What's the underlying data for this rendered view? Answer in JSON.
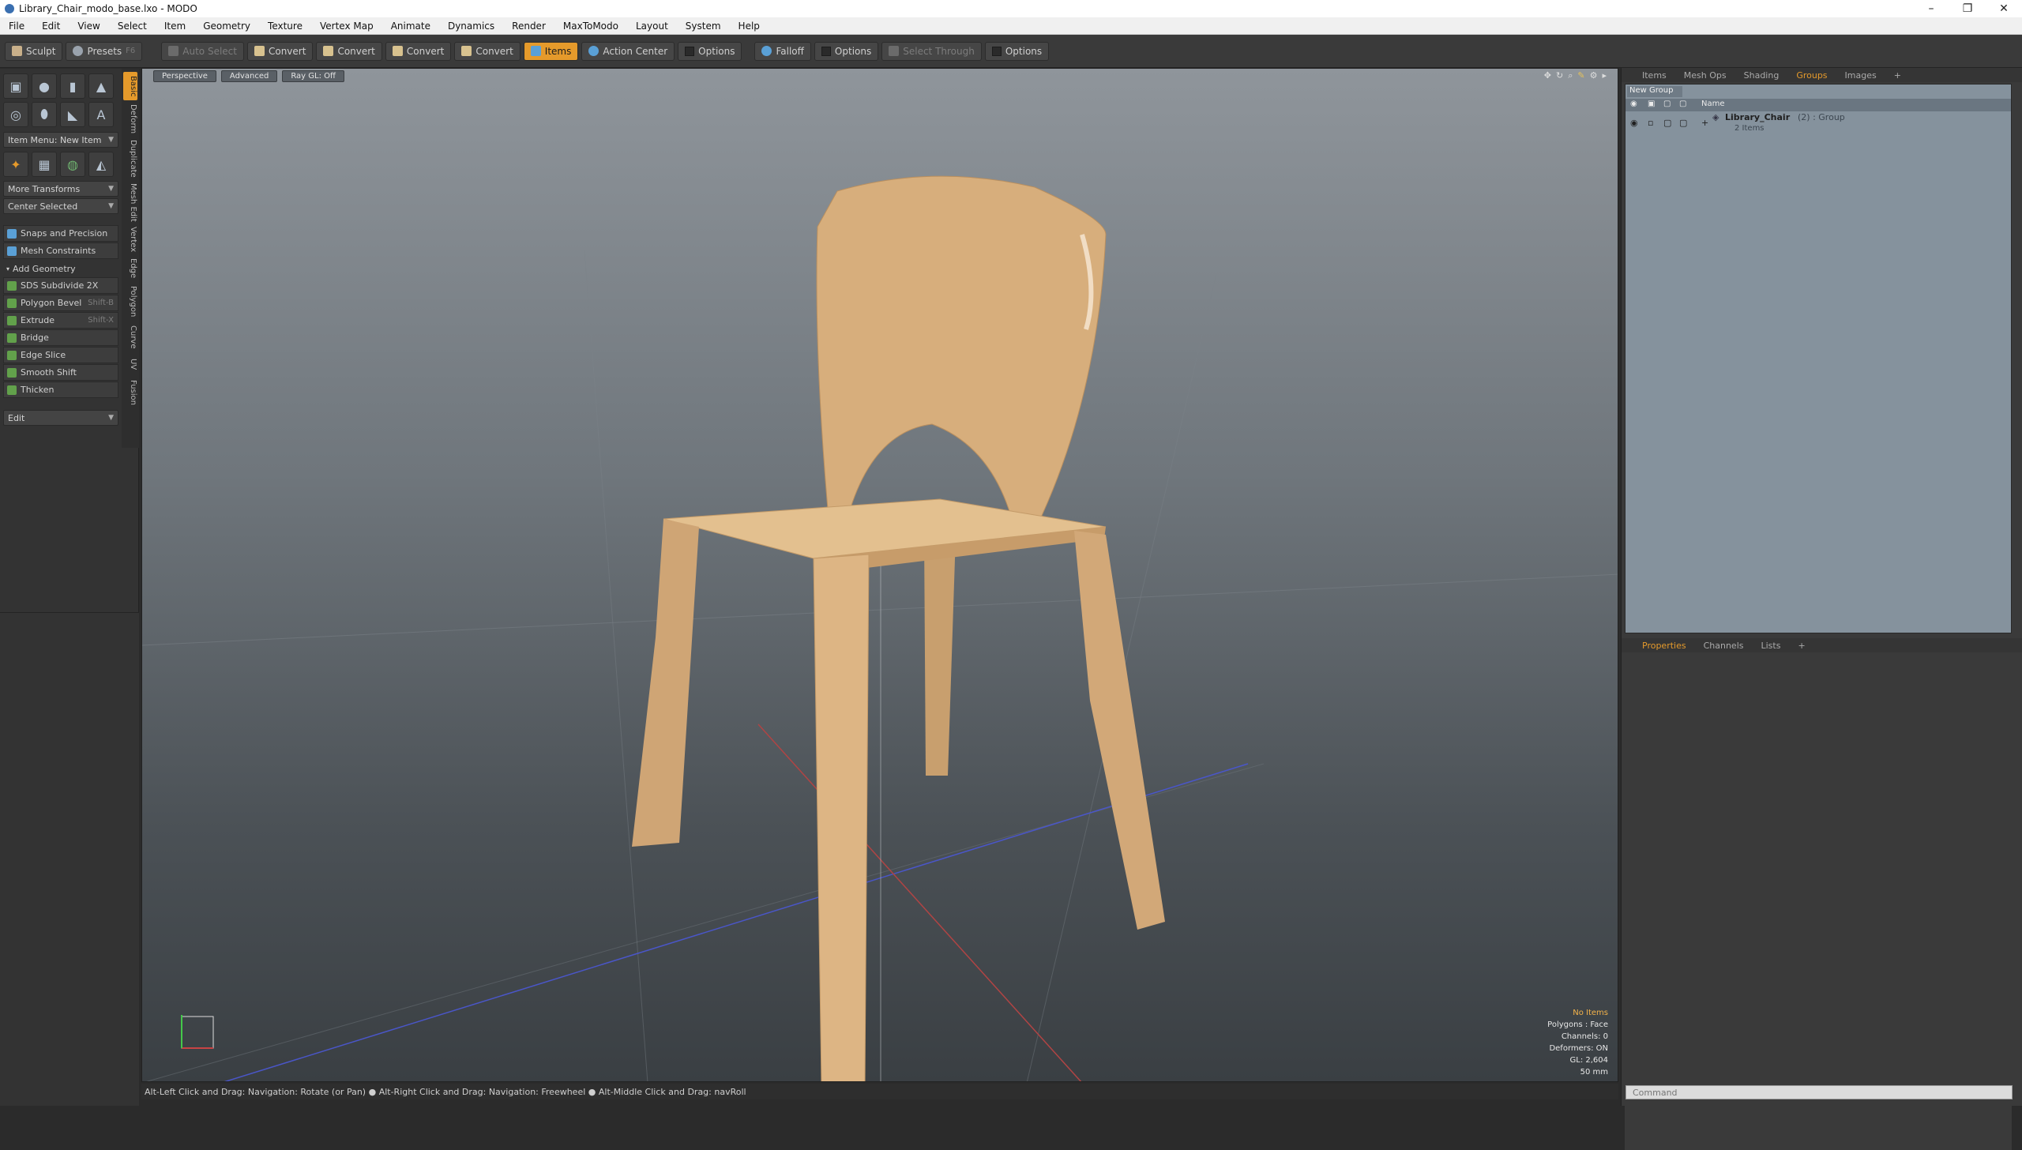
{
  "window": {
    "title": "Library_Chair_modo_base.lxo - MODO",
    "min": "–",
    "max": "❐",
    "close": "✕"
  },
  "menu": [
    "File",
    "Edit",
    "View",
    "Select",
    "Item",
    "Geometry",
    "Texture",
    "Vertex Map",
    "Animate",
    "Dynamics",
    "Render",
    "MaxToModo",
    "Layout",
    "System",
    "Help"
  ],
  "toolbar": {
    "sculpt": "Sculpt",
    "presets": "Presets",
    "presets_key": "F6",
    "auto_select": "Auto Select",
    "convert1": "Convert",
    "convert2": "Convert",
    "convert3": "Convert",
    "convert4": "Convert",
    "items": "Items",
    "action_center": "Action Center",
    "options1": "Options",
    "falloff": "Falloff",
    "options2": "Options",
    "select_through": "Select Through",
    "options3": "Options"
  },
  "left": {
    "item_menu": "Item Menu: New Item",
    "more_transforms": "More Transforms",
    "center_selected": "Center Selected",
    "snaps": "Snaps and Precision",
    "mesh_constraints": "Mesh Constraints",
    "add_geometry": "Add Geometry",
    "tools": [
      {
        "label": "SDS Subdivide 2X",
        "key": ""
      },
      {
        "label": "Polygon Bevel",
        "key": "Shift-B"
      },
      {
        "label": "Extrude",
        "key": "Shift-X"
      },
      {
        "label": "Bridge",
        "key": ""
      },
      {
        "label": "Edge Slice",
        "key": ""
      },
      {
        "label": "Smooth Shift",
        "key": ""
      },
      {
        "label": "Thicken",
        "key": ""
      }
    ],
    "edit": "Edit",
    "sidetabs": [
      "Basic",
      "Deform",
      "Duplicate",
      "Mesh Edit",
      "Vertex",
      "Edge",
      "Polygon",
      "Curve",
      "UV",
      "Fusion"
    ]
  },
  "viewport": {
    "perspective": "Perspective",
    "advanced": "Advanced",
    "raygl": "Ray GL: Off",
    "hud": [
      "No Items",
      "Polygons : Face",
      "Channels: 0",
      "Deformers: ON",
      "GL: 2,604",
      "50 mm"
    ]
  },
  "status": "Alt-Left Click and Drag: Navigation: Rotate (or Pan) ● Alt-Right Click and Drag: Navigation: Freewheel ● Alt-Middle Click and Drag: navRoll",
  "right": {
    "tabs": [
      "Items",
      "Mesh Ops",
      "Shading",
      "Groups",
      "Images",
      "+"
    ],
    "new_group": "New Group",
    "name_col": "Name",
    "group_name": "Library_Chair",
    "group_meta": "(2) : Group",
    "group_items": "2 Items",
    "tabs2": [
      "Properties",
      "Channels",
      "Lists",
      "+"
    ],
    "command_placeholder": "Command"
  },
  "colors": {
    "accent": "#e59a2b",
    "wood": "#d9b383"
  }
}
